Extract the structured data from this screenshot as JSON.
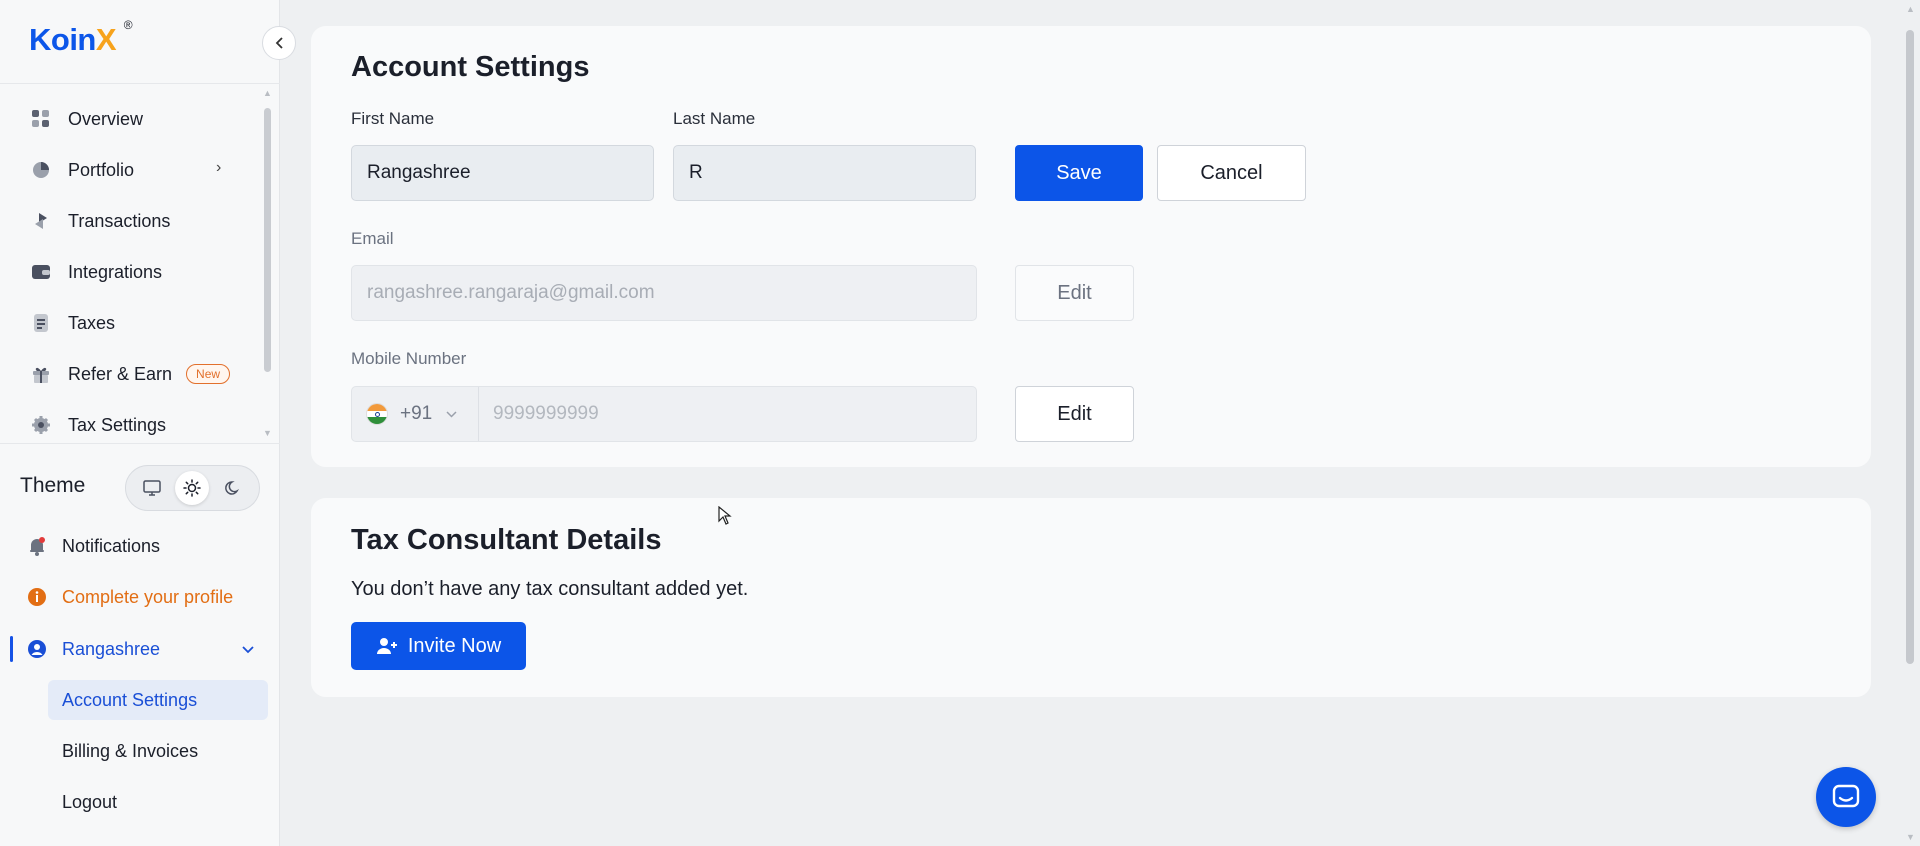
{
  "brand": {
    "name_part1": "Koin",
    "name_part2": "X",
    "reg": "®"
  },
  "sidebar": {
    "collapse_icon": "chevron-left-icon",
    "nav": [
      {
        "label": "Overview",
        "icon": "grid-icon"
      },
      {
        "label": "Portfolio",
        "icon": "pie-chart-icon"
      },
      {
        "label": "Transactions",
        "icon": "transactions-icon"
      },
      {
        "label": "Integrations",
        "icon": "wallet-icon"
      },
      {
        "label": "Taxes",
        "icon": "document-icon"
      },
      {
        "label": "Refer & Earn",
        "icon": "gift-icon",
        "badge": "New"
      },
      {
        "label": "Tax Settings",
        "icon": "gear-icon"
      }
    ],
    "theme": {
      "label": "Theme",
      "options": [
        "monitor-icon",
        "sun-icon",
        "moon-icon"
      ],
      "selected": "light"
    },
    "notifications": "Notifications",
    "complete_profile": "Complete your profile",
    "user": {
      "name": "Rangashree",
      "submenu": [
        "Account Settings",
        "Billing & Invoices",
        "Logout"
      ],
      "active": "Account Settings"
    }
  },
  "account": {
    "title": "Account Settings",
    "first_name_label": "First Name",
    "first_name_value": "Rangashree",
    "last_name_label": "Last Name",
    "last_name_value": "R",
    "save_label": "Save",
    "cancel_label": "Cancel",
    "email_label": "Email",
    "email_value": "rangashree.rangaraja@gmail.com",
    "email_edit_label": "Edit",
    "mobile_label": "Mobile Number",
    "country_code": "+91",
    "mobile_value": "9999999999",
    "mobile_edit_label": "Edit"
  },
  "tax_consultant": {
    "title": "Tax Consultant Details",
    "message": "You don’t have any tax consultant added yet.",
    "invite_label": "Invite Now"
  },
  "colors": {
    "primary": "#0c55e8",
    "warning": "#e26e14",
    "accent_yellow": "#f7a31c"
  }
}
